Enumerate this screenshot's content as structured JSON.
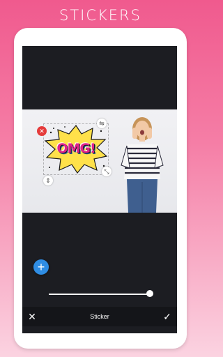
{
  "promo": {
    "title": "STICKERS"
  },
  "sticker": {
    "text": "OMG!"
  },
  "toolbar": {
    "label": "Sticker",
    "close_icon": "close-icon",
    "confirm_icon": "check-icon"
  },
  "controls": {
    "delete_icon": "delete-icon",
    "flip_icon": "flip-icon",
    "scale_icon": "resize-icon",
    "stretch_icon": "stretch-icon"
  },
  "add_button": {
    "icon": "plus-icon"
  },
  "opacity_slider": {
    "value": 0.98
  },
  "colors": {
    "accent_pink": "#f05a8e",
    "delete_red": "#e53b3b",
    "add_blue": "#2f8de4",
    "sticker_yellow": "#ffe14a",
    "sticker_magenta": "#e0238a"
  }
}
